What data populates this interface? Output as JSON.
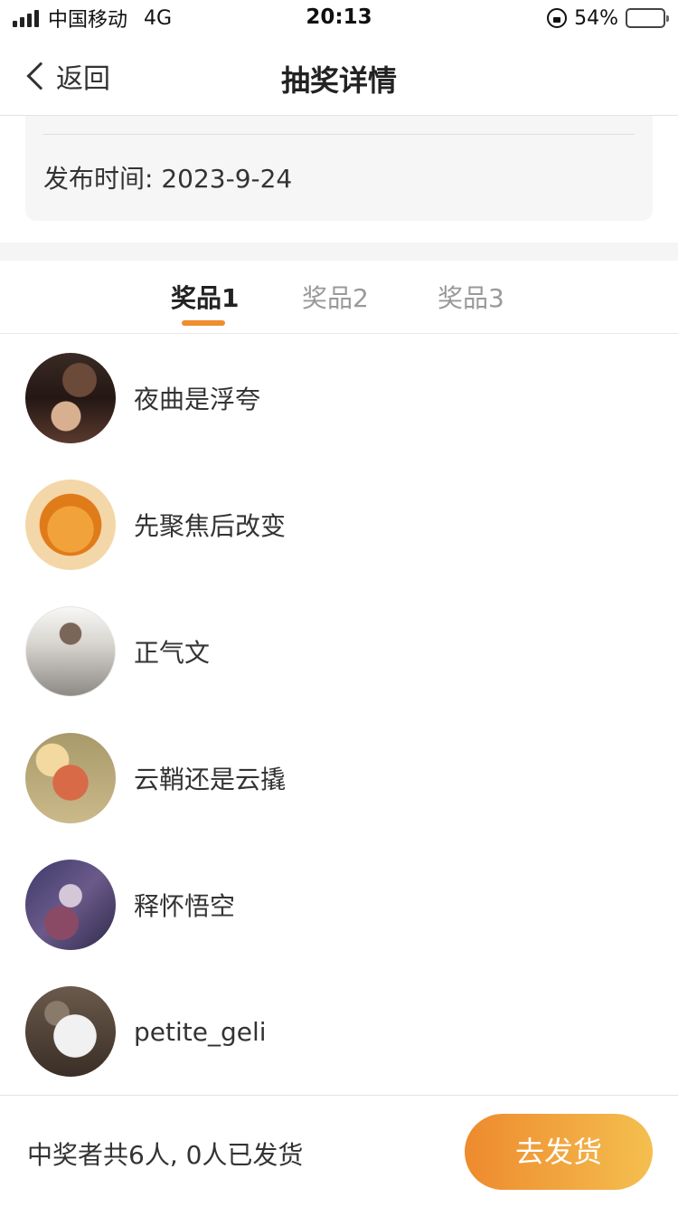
{
  "status_bar": {
    "carrier": "中国移动",
    "network": "4G",
    "time": "20:13",
    "battery": "54%",
    "battery_level": 0.54
  },
  "nav": {
    "back_label": "返回",
    "title": "抽奖详情"
  },
  "info": {
    "publish_time": "发布时间: 2023-9-24"
  },
  "tabs": [
    {
      "label": "奖品1",
      "active": true
    },
    {
      "label": "奖品2",
      "active": false
    },
    {
      "label": "奖品3",
      "active": false
    }
  ],
  "winners": [
    {
      "name": "夜曲是浮夸"
    },
    {
      "name": "先聚焦后改变"
    },
    {
      "name": "正气文"
    },
    {
      "name": "云鞘还是云撬"
    },
    {
      "name": "释怀悟空"
    },
    {
      "name": "petite_geli"
    }
  ],
  "footer": {
    "summary": "中奖者共6人, 0人已发货",
    "ship_button": "去发货"
  },
  "colors": {
    "accent": "#ef8d2f",
    "button_start": "#ee8a2e",
    "button_end": "#f4bf4f"
  }
}
